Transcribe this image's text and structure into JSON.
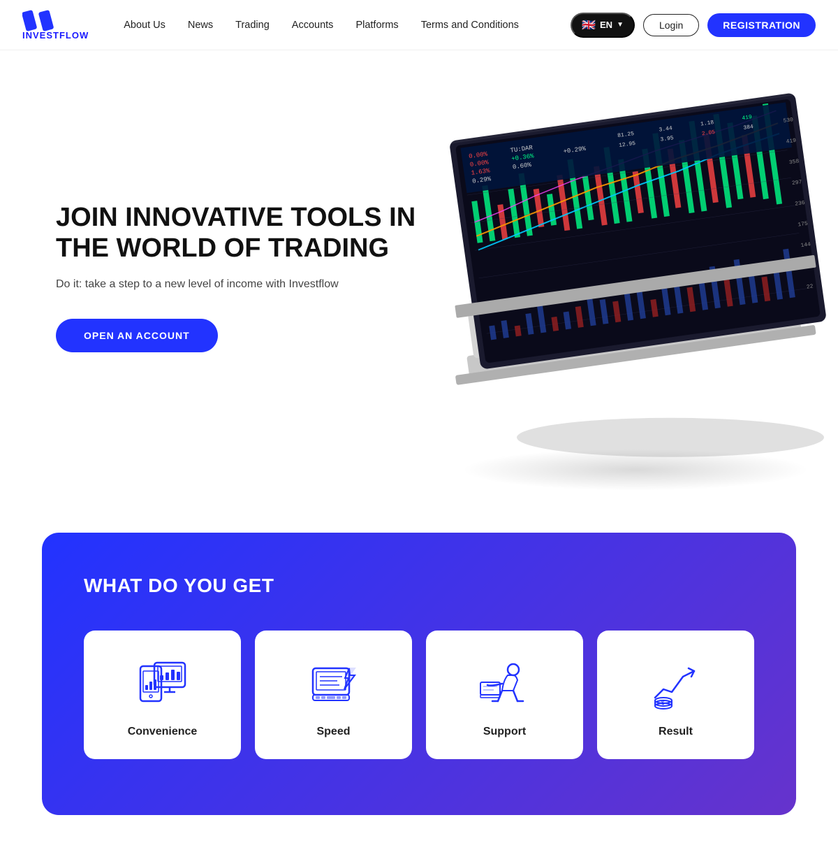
{
  "header": {
    "logo_text": "INVESTFLOW",
    "nav_items": [
      {
        "label": "About Us",
        "id": "about-us"
      },
      {
        "label": "News",
        "id": "news"
      },
      {
        "label": "Trading",
        "id": "trading"
      },
      {
        "label": "Accounts",
        "id": "accounts"
      },
      {
        "label": "Platforms",
        "id": "platforms"
      },
      {
        "label": "Terms and Conditions",
        "id": "terms"
      }
    ],
    "lang_label": "EN",
    "lang_flag": "🇬🇧",
    "login_label": "Login",
    "registration_label": "REGISTRATION"
  },
  "hero": {
    "title": "JOIN INNOVATIVE TOOLS IN THE WORLD OF TRADING",
    "subtitle": "Do it: take a step to a new level of income with Investflow",
    "cta_label": "OPEN AN ACCOUNT"
  },
  "features": {
    "section_title": "WHAT DO YOU GET",
    "cards": [
      {
        "label": "Convenience",
        "icon": "convenience"
      },
      {
        "label": "Speed",
        "icon": "speed"
      },
      {
        "label": "Support",
        "icon": "support"
      },
      {
        "label": "Result",
        "icon": "result"
      }
    ]
  }
}
